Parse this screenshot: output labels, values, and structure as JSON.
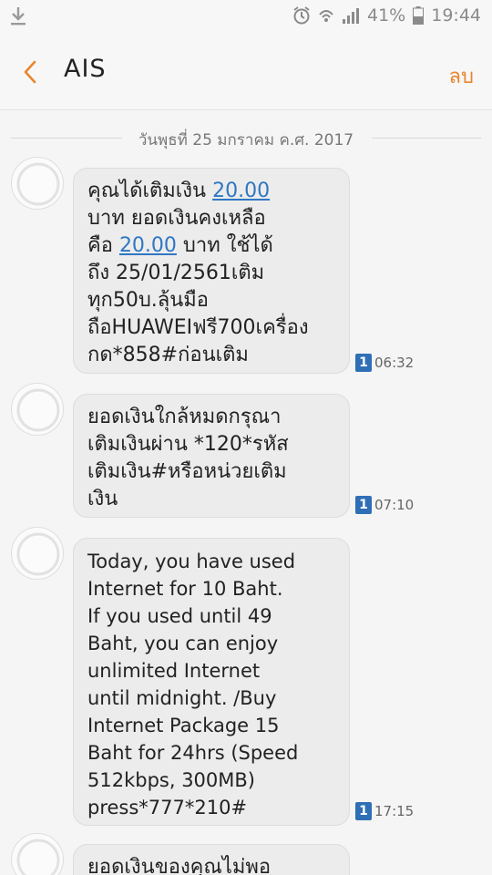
{
  "status_bar": {
    "battery_percent": "41%",
    "time": "19:44",
    "icons": [
      "download-icon",
      "alarm-icon",
      "wifi-icon",
      "signal-icon",
      "battery-icon"
    ]
  },
  "app_bar": {
    "title": "AIS",
    "delete_label": "ลบ",
    "icons": [
      "back-icon"
    ]
  },
  "date_divider": "วันพุธที่ 25 มกราคม ค.ศ. 2017",
  "colors": {
    "accent": "#e8862b",
    "link": "#2e77c4",
    "sim_badge": "#2f6fb6",
    "bubble": "#ececec"
  },
  "messages": [
    {
      "part1": "คุณได้เติมเงิน ",
      "link1": "20.00",
      "part2": "\nบาท ยอดเงินคงเหลือ\nคือ ",
      "link2": "20.00",
      "part3": " บาท ใช้ได้\nถึง 25/01/2561เติม\nทุก50บ.ลุ้นมือ\nถือHUAWEIฟรี700เครื่อง\nกด*858#ก่อนเติม",
      "sim": "1",
      "time": "06:32"
    },
    {
      "text": "ยอดเงินใกล้หมดกรุณา\nเติมเงินผ่าน *120*รหัส\nเติมเงิน#หรือหน่วยเติม\nเงิน",
      "sim": "1",
      "time": "07:10"
    },
    {
      "text": "Today, you have used\nInternet for 10 Baht.\nIf you used until 49\nBaht, you can enjoy\nunlimited Internet\nuntil midnight. /Buy\nInternet Package 15\nBaht for 24hrs (Speed\n512kbps, 300MB)\npress*777*210#",
      "sim": "1",
      "time": "17:15"
    },
    {
      "text": "ยอดเงินของคุณไม่พอ"
    }
  ]
}
